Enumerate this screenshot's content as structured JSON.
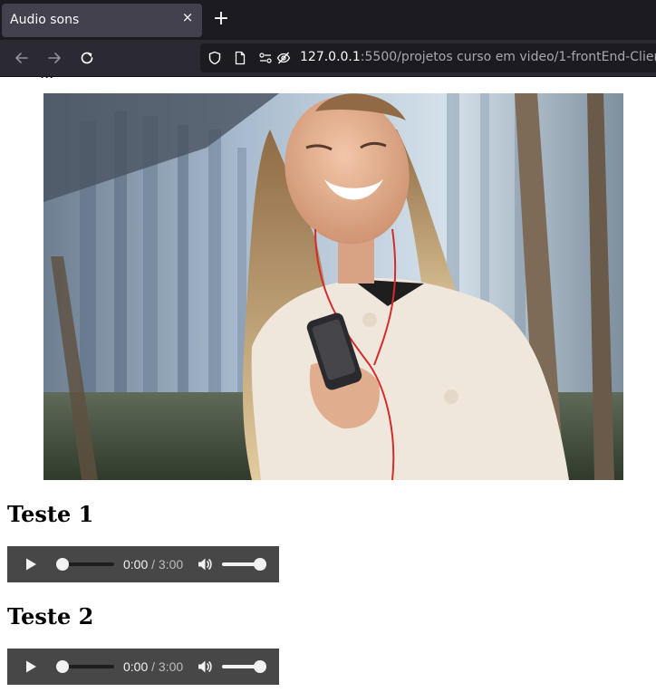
{
  "browser": {
    "tab_title": "Audio sons",
    "tab_close_glyph": "×",
    "new_tab_glyph": "+",
    "url_host": "127.0.0.1",
    "url_rest": ":5500/projetos curso em video/1-frontEnd-Clien"
  },
  "page": {
    "top_cut_text": "...",
    "image": {
      "subject": "woman smiling holding phone with red earphones",
      "colors": {
        "building": "#8ca2b8",
        "coat": "#efe7dc",
        "hair": "#c9a877",
        "trees": "#6b5a48"
      }
    },
    "players": [
      {
        "heading": "Teste 1",
        "current_time": "0:00",
        "duration": " / 3:00",
        "progress": 0.0,
        "volume": 1.0
      },
      {
        "heading": "Teste 2",
        "current_time": "0:00",
        "duration": " / 3:00",
        "progress": 0.0,
        "volume": 1.0
      }
    ]
  },
  "colors": {
    "tabbar_bg": "#1c1b22",
    "tab_bg": "#42414d",
    "navbar_bg": "#2b2a33",
    "player_bg": "#474747"
  },
  "icons": [
    "close-icon",
    "plus-icon",
    "back-arrow-icon",
    "forward-arrow-icon",
    "reload-icon",
    "shield-icon",
    "page-icon",
    "permissions-icon",
    "tracking-blocked-icon",
    "play-icon",
    "volume-icon"
  ]
}
